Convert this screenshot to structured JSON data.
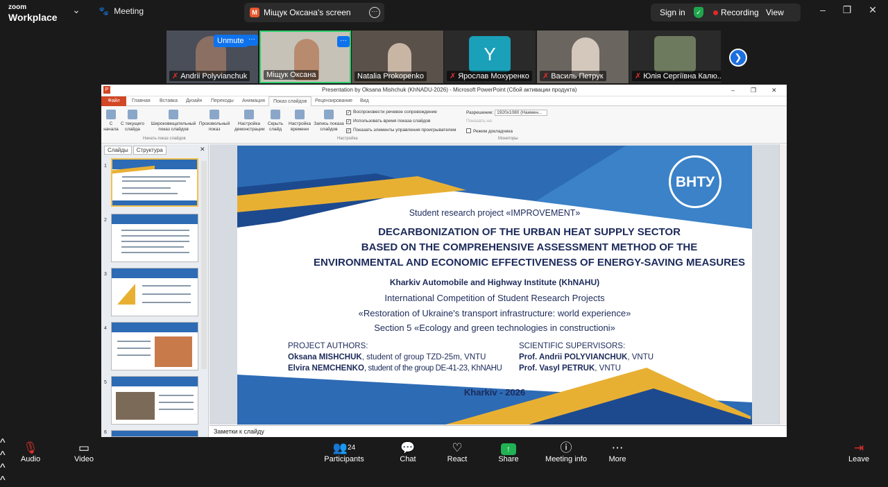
{
  "topbar": {
    "brand_small": "zoom",
    "brand_large": "Workplace",
    "meeting_label": "Meeting",
    "share_tab_letter": "M",
    "share_tab_title": "Міщук Оксана's screen",
    "sign_in": "Sign in",
    "recording": "Recording",
    "view": "View"
  },
  "participants": [
    {
      "name": "Andrii Polyvianchuk",
      "muted": true
    },
    {
      "name": "Міщук Оксана",
      "muted": false
    },
    {
      "name": "Natalia Prokopenko",
      "muted": false
    },
    {
      "name": "Ярослав Мохуренко",
      "muted": true
    },
    {
      "name": "Василь Петрук",
      "muted": true
    },
    {
      "name": "Юлія Сергіївна Калю...",
      "muted": true
    }
  ],
  "gallery": {
    "unmute_label": "Unmute",
    "avatar_letter": "Y"
  },
  "ppt": {
    "window_title": "Presentation by Oksana Mishchuk (KhNADU-2026) - Microsoft PowerPoint (Сбой активации продукта)",
    "tabs": [
      "Файл",
      "Главная",
      "Вставка",
      "Дизайн",
      "Переходы",
      "Анимация",
      "Показ слайдов",
      "Рецензирование",
      "Вид"
    ],
    "ribbon_buttons": [
      "С начала",
      "С текущего слайда",
      "Широковещательный показ слайдов",
      "Произвольный показ",
      "Настройка демонстрации",
      "Скрыть слайд",
      "Настройка времени",
      "Запись показа слайдов"
    ],
    "checkboxes": [
      "Воспроизвести речевое сопровождение",
      "Использовать время показа слайдов",
      "Показать элементы управления проигрывателем"
    ],
    "resolution_label": "Разрешение:",
    "resolution_value": "1920x1080 (Наимен...",
    "show_on_label": "Показать на:",
    "presenter_view": "Режим докладчика",
    "groups": [
      "Начать показ слайдов",
      "Настройка",
      "Мониторы"
    ],
    "panel_tabs": [
      "Слайды",
      "Структура"
    ],
    "notes_placeholder": "Заметки к слайду",
    "slide_numbers": [
      "1",
      "2",
      "3",
      "4",
      "5",
      "6"
    ]
  },
  "slide": {
    "logo_text": "ВНТУ",
    "project": "Student research project «IMPROVEMENT»",
    "title_lines": [
      "DECARBONIZATION OF THE URBAN HEAT SUPPLY SECTOR",
      "BASED ON THE COMPREHENSIVE ASSESSMENT METHOD OF THE",
      "ENVIRONMENTAL AND ECONOMIC EFFECTIVENESS OF ENERGY-SAVING MEASURES"
    ],
    "institute": "Kharkiv Automobile and Highway Institute (KhNAHU)",
    "competition": "International Competition of Student Research Projects",
    "restoration": "«Restoration of Ukraine's transport infrastructure: world experience»",
    "section": "Section 5 «Ecology and green technologies in constructioni»",
    "authors_heading": "PROJECT AUTHORS:",
    "author1_bold": "Oksana MISHCHUK",
    "author1_rest": ", student of group TZD-25m, VNTU",
    "author2_bold": "Elvira NEMCHENKO",
    "author2_rest": ", student of the group DE-41-23, KhNAHU",
    "supervisors_heading": "SCIENTIFIC SUPERVISORS:",
    "sup1_bold": "Prof. Andrii POLYVIANCHUK",
    "sup1_rest": ", VNTU",
    "sup2_bold": "Prof. Vasyl PETRUK",
    "sup2_rest": ", VNTU",
    "footer": "Kharkiv - 2026"
  },
  "bottombar": {
    "audio": "Audio",
    "video": "Video",
    "participants": "Participants",
    "participants_count": "24",
    "chat": "Chat",
    "react": "React",
    "share": "Share",
    "meeting_info": "Meeting info",
    "more": "More",
    "leave": "Leave"
  },
  "colors": {
    "accent": "#0e72ed",
    "share_green": "#20b253",
    "slide_blue": "#2d6bb5",
    "slide_gold": "#e8b033",
    "ppt_orange": "#d24726"
  }
}
